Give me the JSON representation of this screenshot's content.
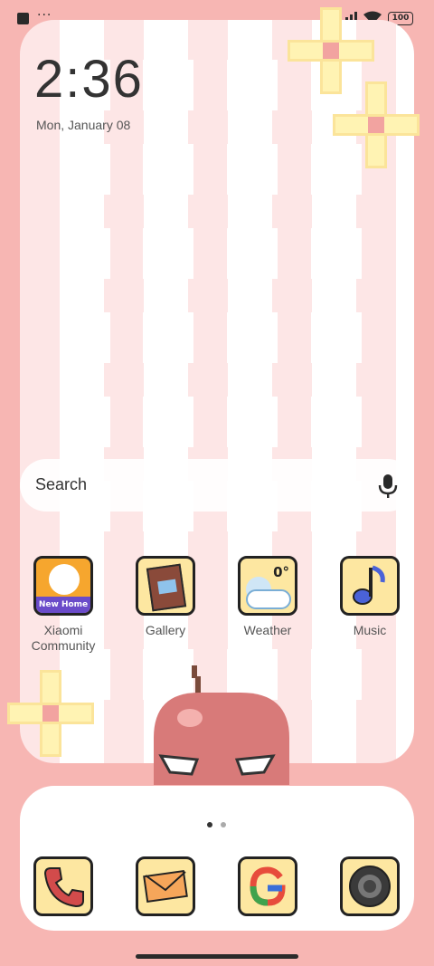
{
  "status_bar": {
    "more_indicator": "···",
    "battery": "100",
    "icons": [
      "notification-square-icon",
      "signal-icon",
      "wifi-icon",
      "battery-icon"
    ]
  },
  "lockscreen": {
    "time": "2:36",
    "date": "Mon, January 08"
  },
  "search": {
    "label": "Search",
    "icon": "mic-icon"
  },
  "apps": [
    {
      "label": "Xiaomi\nCommunity",
      "icon": "xiaomi-community-icon",
      "badge_text": "New Home"
    },
    {
      "label": "Gallery",
      "icon": "gallery-icon"
    },
    {
      "label": "Weather",
      "icon": "weather-icon",
      "temp": "0°"
    },
    {
      "label": "Music",
      "icon": "music-icon"
    }
  ],
  "dock": {
    "page_indicator": {
      "pages": 2,
      "active": 0
    },
    "apps": [
      {
        "name": "Phone",
        "icon": "phone-icon"
      },
      {
        "name": "Messages",
        "icon": "envelope-icon"
      },
      {
        "name": "Google",
        "icon": "google-icon"
      },
      {
        "name": "Camera",
        "icon": "camera-icon"
      }
    ]
  },
  "colors": {
    "background": "#f7b6b3",
    "panel": "#fde6e6",
    "icon_bg": "#fde7a1",
    "flower": "#fff3b3",
    "flower_center": "#f2a3a0",
    "apple": "#d87a79"
  }
}
